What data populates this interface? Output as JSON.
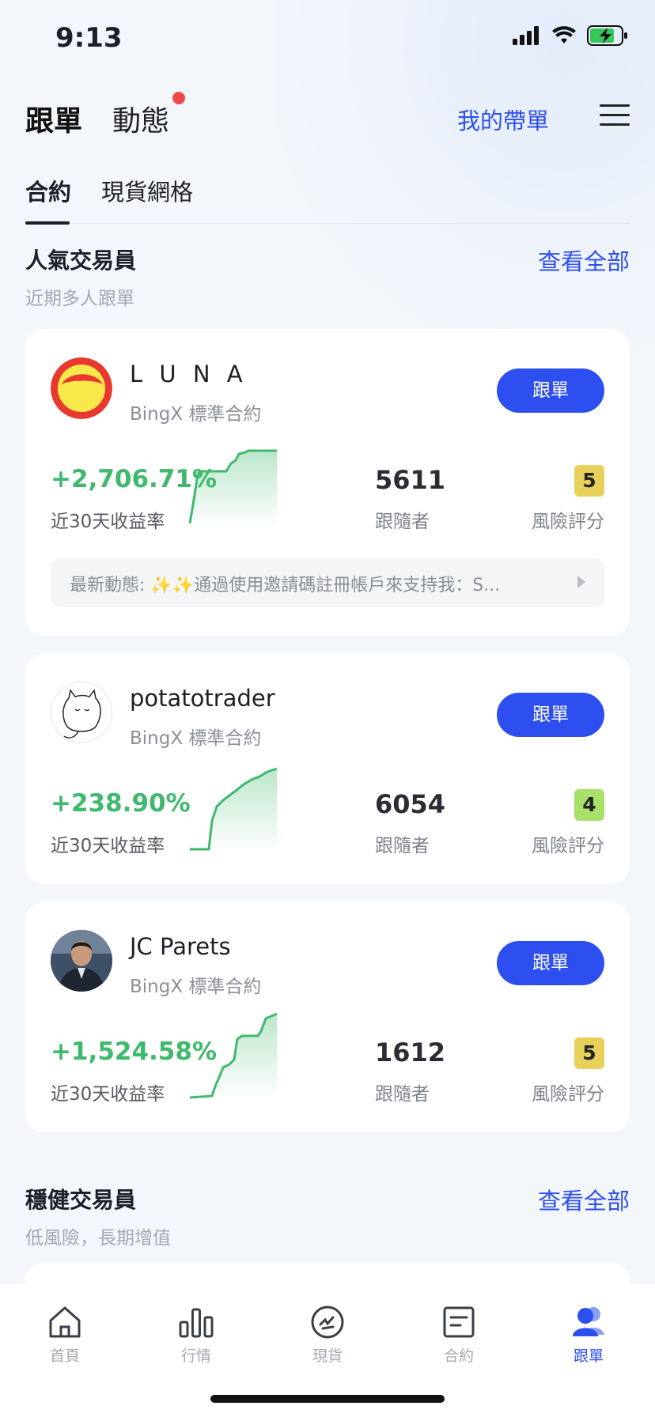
{
  "status": {
    "time": "9:13"
  },
  "nav": {
    "tab_active": "跟單",
    "tab_second": "動態",
    "my_lead": "我的帶單"
  },
  "sub_tabs": {
    "active": "合約",
    "second": "現貨網格"
  },
  "popular": {
    "title": "人氣交易員",
    "subtitle": "近期多人跟單",
    "view_all": "查看全部",
    "traders": [
      {
        "name": "L U N A",
        "type": "BingX 標準合約",
        "follow_label": "跟單",
        "roi": "+2,706.71%",
        "roi_label": "近30天收益率",
        "followers": "5611",
        "followers_label": "跟隨者",
        "risk": "5",
        "risk_label": "風險評分",
        "risk_color": "#e8d15a",
        "latest": "最新動態: ✨✨通過使用邀請碼註冊帳戶來支持我：S...",
        "avatar_icon": "luna-logo-icon"
      },
      {
        "name": "potatotrader",
        "type": "BingX 標準合約",
        "follow_label": "跟單",
        "roi": "+238.90%",
        "roi_label": "近30天收益率",
        "followers": "6054",
        "followers_label": "跟隨者",
        "risk": "4",
        "risk_label": "風險評分",
        "risk_color": "#a8e06a",
        "avatar_icon": "cat-sketch-avatar-icon"
      },
      {
        "name": "JC Parets",
        "type": "BingX 標準合約",
        "follow_label": "跟單",
        "roi": "+1,524.58%",
        "roi_label": "近30天收益率",
        "followers": "1612",
        "followers_label": "跟隨者",
        "risk": "5",
        "risk_label": "風險評分",
        "risk_color": "#e8d15a",
        "avatar_icon": "person-photo-avatar-icon"
      }
    ]
  },
  "steady": {
    "title": "穩健交易員",
    "subtitle": "低風險，長期增值",
    "view_all": "查看全部"
  },
  "tab_bar": {
    "items": [
      {
        "label": "首頁",
        "icon": "home-icon"
      },
      {
        "label": "行情",
        "icon": "bar-chart-icon"
      },
      {
        "label": "現貨",
        "icon": "spot-icon"
      },
      {
        "label": "合約",
        "icon": "contract-icon"
      },
      {
        "label": "跟單",
        "icon": "copy-trade-icon",
        "active": true
      }
    ]
  },
  "colors": {
    "accent": "#2d4ff0",
    "positive": "#3fb96d",
    "notification": "#f0494b"
  }
}
